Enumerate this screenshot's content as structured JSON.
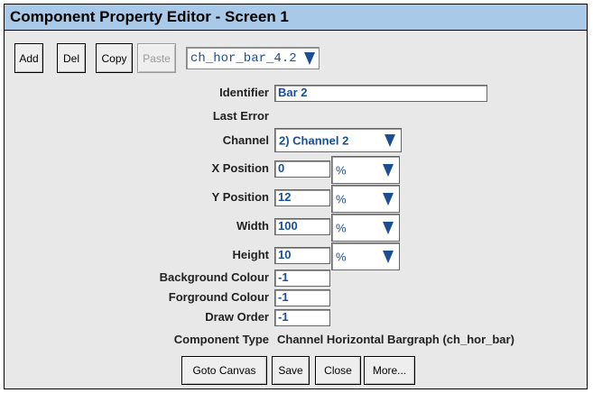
{
  "window": {
    "title": "Component Property Editor - Screen 1"
  },
  "toolbar": {
    "add_label": "Add",
    "del_label": "Del",
    "copy_label": "Copy",
    "paste_label": "Paste",
    "component_select": "ch_hor_bar_4.2"
  },
  "form": {
    "identifier": {
      "label": "Identifier",
      "value": "Bar 2"
    },
    "last_error": {
      "label": "Last Error"
    },
    "channel": {
      "label": "Channel",
      "value": "2) Channel 2"
    },
    "x_position": {
      "label": "X Position",
      "value": "0",
      "unit": "%"
    },
    "y_position": {
      "label": "Y Position",
      "value": "12",
      "unit": "%"
    },
    "width": {
      "label": "Width",
      "value": "100",
      "unit": "%"
    },
    "height": {
      "label": "Height",
      "value": "10",
      "unit": "%"
    },
    "background_colour": {
      "label": "Background Colour",
      "value": "-1"
    },
    "forground_colour": {
      "label": "Forground Colour",
      "value": "-1"
    },
    "draw_order": {
      "label": "Draw Order",
      "value": "-1"
    },
    "component_type": {
      "label": "Component Type",
      "value": "Channel Horizontal Bargraph (ch_hor_bar)"
    }
  },
  "footer": {
    "goto_canvas_label": "Goto Canvas",
    "save_label": "Save",
    "close_label": "Close",
    "more_label": "More..."
  },
  "colors": {
    "title_bar": "#a9c9e8",
    "value_text": "#1a4f96",
    "panel": "#e8e8e8"
  }
}
